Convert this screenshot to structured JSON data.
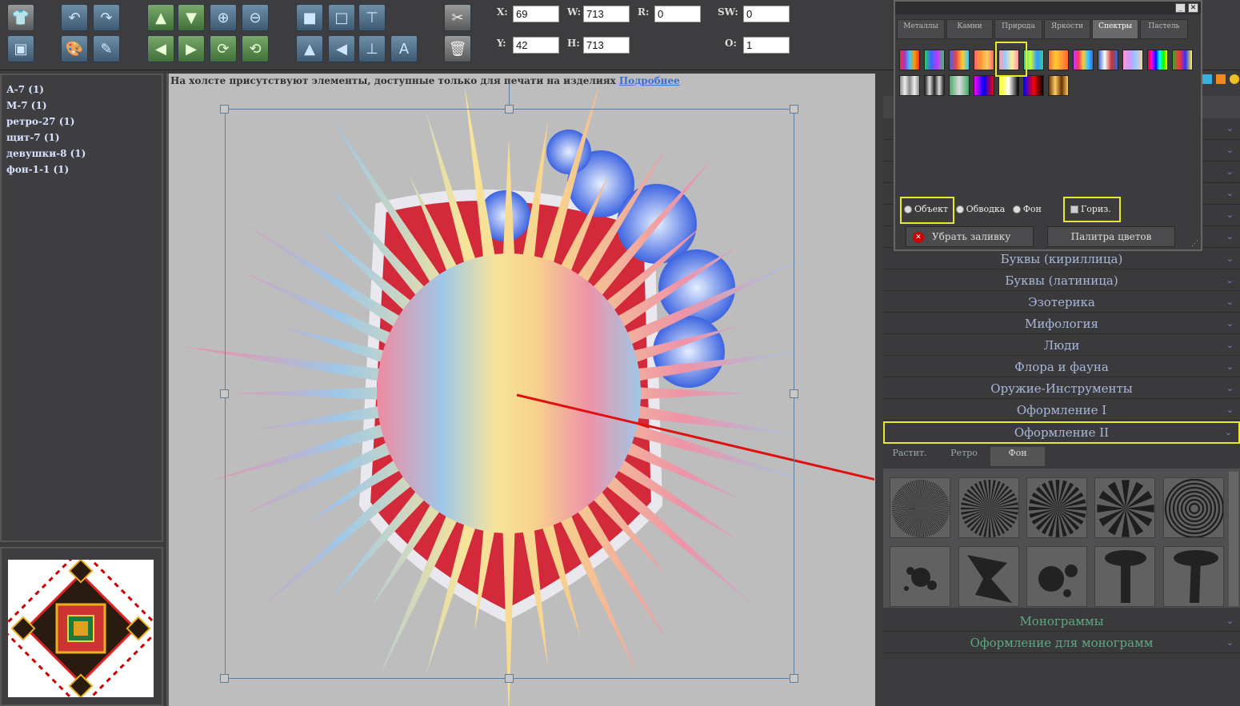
{
  "toolbar": {
    "fields": {
      "x": {
        "label": "X:",
        "value": "69"
      },
      "y": {
        "label": "Y:",
        "value": "42"
      },
      "w": {
        "label": "W:",
        "value": "713"
      },
      "h": {
        "label": "H:",
        "value": "713"
      },
      "r": {
        "label": "R:",
        "value": "0"
      },
      "sw": {
        "label": "SW:",
        "value": "0"
      },
      "o": {
        "label": "O:",
        "value": "1"
      }
    }
  },
  "layers": [
    "А-7 (1)",
    "М-7 (1)",
    "ретро-27 (1)",
    "щит-7 (1)",
    "девушки-8 (1)",
    "фон-1-1 (1)"
  ],
  "notice": {
    "text": "На холсте присутствуют элементы, доступные только для печати на изделиях",
    "link": "Подробнее"
  },
  "palette": {
    "tabs": [
      "Металлы",
      "Камни",
      "Природа",
      "Яркости",
      "Спектры",
      "Пастель"
    ],
    "active_tab": "Спектры",
    "radio": {
      "object": "Объект",
      "stroke": "Обводка",
      "background": "Фон"
    },
    "checkbox": "Гориз.",
    "remove_fill": "Убрать заливку",
    "color_palette": "Палитра цветов"
  },
  "categories": [
    "Буквы (кириллица)",
    "Буквы (латиница)",
    "Эзотерика",
    "Мифология",
    "Люди",
    "Флора и фауна",
    "Оружие-Инструменты",
    "Оформление I",
    "Оформление II"
  ],
  "subtabs": [
    "Растит.",
    "Ретро",
    "Фон"
  ],
  "bottom_categories": [
    "Монограммы",
    "Оформление для монограмм"
  ],
  "colors": {
    "accent_highlight": "#e8e830",
    "arrow": "#e01010",
    "category_text": "#a9b7d8",
    "monogram_text": "#5ea882"
  }
}
